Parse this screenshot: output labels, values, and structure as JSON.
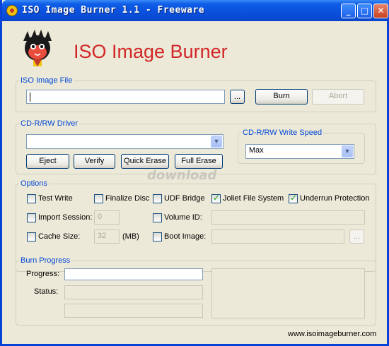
{
  "window": {
    "title": "ISO Image Burner 1.1 - Freeware"
  },
  "brand": {
    "title": "ISO Image Burner"
  },
  "iso_image_file": {
    "legend": "ISO Image File",
    "path_value": "",
    "browse_label": "...",
    "burn_label": "Burn",
    "abort_label": "Abort"
  },
  "driver": {
    "legend": "CD-R/RW Driver",
    "selected": "",
    "eject_label": "Eject",
    "verify_label": "Verify",
    "quick_erase_label": "Quick Erase",
    "full_erase_label": "Full Erase"
  },
  "write_speed": {
    "legend": "CD-R/RW Write Speed",
    "selected": "Max"
  },
  "options": {
    "legend": "Options",
    "test_write": {
      "label": "Test Write",
      "checked": false
    },
    "finalize_disc": {
      "label": "Finalize Disc",
      "checked": false
    },
    "udf_bridge": {
      "label": "UDF Bridge",
      "checked": false
    },
    "joliet": {
      "label": "Joliet File System",
      "checked": true
    },
    "underrun": {
      "label": "Underrun Protection",
      "checked": true
    },
    "import_session": {
      "label": "Import Session:",
      "checked": false,
      "value": "0"
    },
    "volume_id": {
      "label": "Volume ID:",
      "checked": false,
      "value": ""
    },
    "cache_size": {
      "label": "Cache Size:",
      "checked": false,
      "value": "32",
      "unit": "(MB)"
    },
    "boot_image": {
      "label": "Boot Image:",
      "checked": false,
      "value": "",
      "browse_label": "..."
    }
  },
  "burn_progress": {
    "legend": "Burn Progress",
    "progress_label": "Progress:",
    "status_label": "Status:",
    "progress_fraction": 0
  },
  "watermark": "download",
  "footer": {
    "url": "www.isoimageburner.com"
  }
}
